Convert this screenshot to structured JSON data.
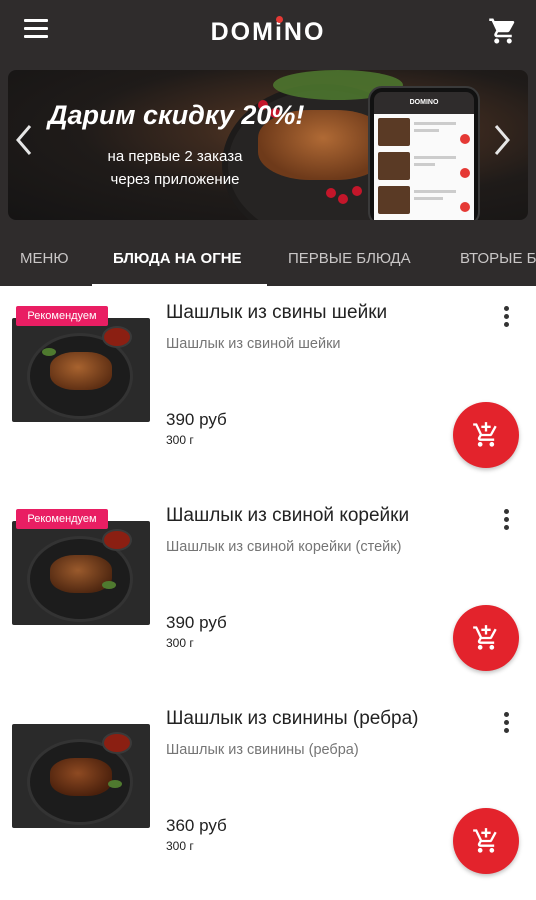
{
  "header": {
    "logo_text_a": "DOM",
    "logo_text_i": "i",
    "logo_text_b": "NO",
    "menu_icon": "hamburger-menu-icon",
    "cart_icon": "shopping-cart-icon"
  },
  "banner": {
    "title": "Дарим скидку 20%!",
    "subtitle_line1": "на первые 2 заказа",
    "subtitle_line2": "через приложение",
    "phone_logo": "DOMINO",
    "prev_icon": "chevron-left-icon",
    "next_icon": "chevron-right-icon"
  },
  "tabs": [
    {
      "label": "МЕНЮ",
      "active": false
    },
    {
      "label": "БЛЮДА НА ОГНЕ",
      "active": true
    },
    {
      "label": "ПЕРВЫЕ БЛЮДА",
      "active": false
    },
    {
      "label": "ВТОРЫЕ БЛЮДА",
      "active": false
    }
  ],
  "products": [
    {
      "badge": "Рекомендуем",
      "title": "Шашлык из свины шейки",
      "description": "Шашлык из свиной шейки",
      "price": "390 руб",
      "weight": "300 г"
    },
    {
      "badge": "Рекомендуем",
      "title": "Шашлык из свиной корейки",
      "description": "Шашлык из свиной корейки (стейк)",
      "price": "390 руб",
      "weight": "300 г"
    },
    {
      "badge": "",
      "title": "Шашлык из свинины (ребра)",
      "description": "Шашлык из свинины (ребра)",
      "price": "360 руб",
      "weight": "300 г"
    }
  ],
  "colors": {
    "header_bg": "#2f2c2c",
    "accent_red": "#e3232c",
    "badge_pink": "#e91e63"
  }
}
